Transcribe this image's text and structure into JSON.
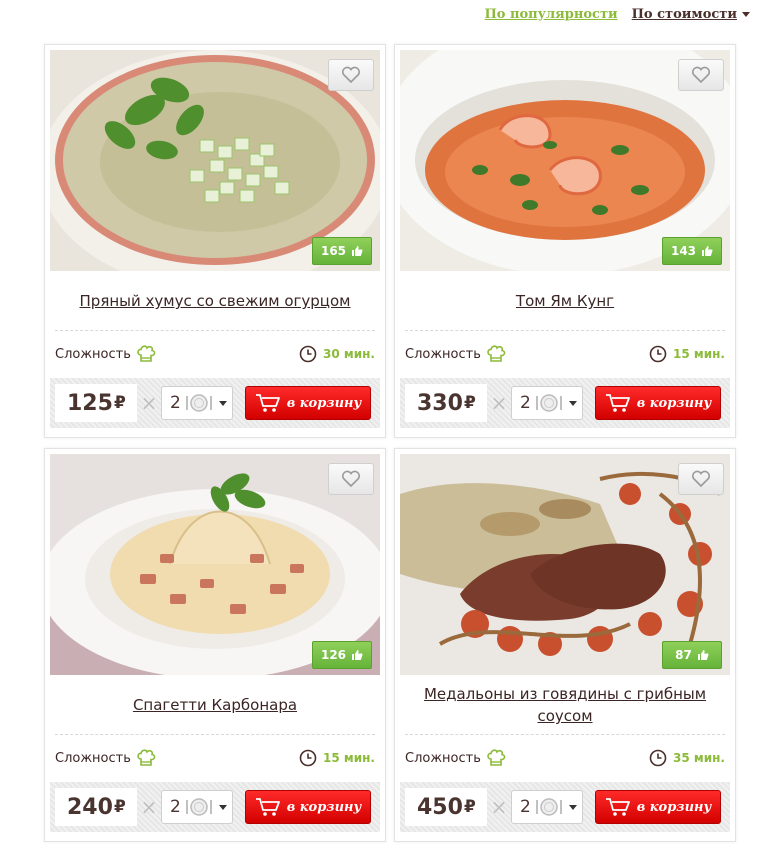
{
  "sort": {
    "popularity_label": "По популярности",
    "price_label": "По стоимости"
  },
  "cards": [
    {
      "title": "Пряный хумус со свежим огурцом",
      "likes": "165",
      "difficulty_label": "Сложность",
      "time": "30 мин.",
      "price": "125",
      "currency": "₽",
      "portions": "2",
      "cart_label": "в корзину"
    },
    {
      "title": "Том Ям Кунг",
      "likes": "143",
      "difficulty_label": "Сложность",
      "time": "15 мин.",
      "price": "330",
      "currency": "₽",
      "portions": "2",
      "cart_label": "в корзину"
    },
    {
      "title": "Спагетти Карбонара",
      "likes": "126",
      "difficulty_label": "Сложность",
      "time": "15 мин.",
      "price": "240",
      "currency": "₽",
      "portions": "2",
      "cart_label": "в корзину"
    },
    {
      "title": "Медальоны из говядины с грибным соусом",
      "likes": "87",
      "difficulty_label": "Сложность",
      "time": "35 мин.",
      "price": "450",
      "currency": "₽",
      "portions": "2",
      "cart_label": "в корзину"
    }
  ],
  "colors": {
    "accent_green": "#8cbb3a",
    "cart_red": "#e00000",
    "text_brown": "#3b2525"
  },
  "icons": [
    "heart-icon",
    "thumbs-up-icon",
    "chef-hat-icon",
    "clock-icon",
    "plate-icon",
    "cart-icon",
    "chevron-down-icon"
  ]
}
